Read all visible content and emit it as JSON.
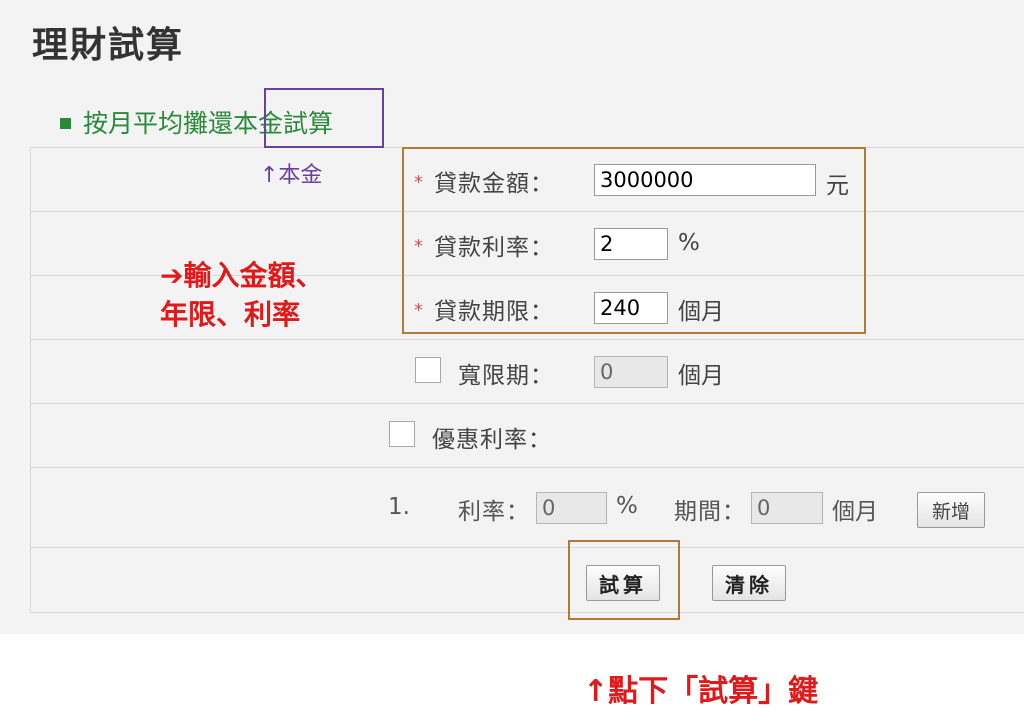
{
  "header": {
    "title": "理財試算"
  },
  "section": {
    "title_part1": "按月平均攤還",
    "title_part2": "本金試算"
  },
  "form": {
    "loan_amount": {
      "label": "貸款金額：",
      "value": "3000000",
      "unit": "元"
    },
    "interest_rate": {
      "label": "貸款利率：",
      "value": "2",
      "unit": "%"
    },
    "loan_term": {
      "label": "貸款期限：",
      "value": "240",
      "unit": "個月"
    },
    "grace_period": {
      "label": "寬限期：",
      "value": "0",
      "unit": "個月"
    },
    "preferential_rate": {
      "label": "優惠利率："
    },
    "rate_row": {
      "index": "1.",
      "rate_label": "利率：",
      "rate_value": "0",
      "rate_unit": "%",
      "period_label": "期間：",
      "period_value": "0",
      "period_unit": "個月",
      "add_label": "新增"
    },
    "buttons": {
      "calculate": "試算",
      "clear": "清除"
    },
    "required_mark": "*"
  },
  "annotations": {
    "principal_note": "↑本金",
    "input_note_line1": "➔輸入金額、",
    "input_note_line2": "年限、利率",
    "click_note": "↑點下「試算」鍵",
    "colors": {
      "purple": "#6b3fa0",
      "brown": "#b07a3a",
      "red": "#e0191b"
    }
  }
}
